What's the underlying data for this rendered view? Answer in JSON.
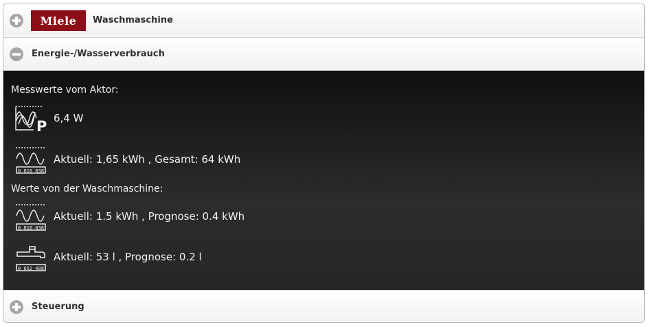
{
  "header": {
    "logo_text": "Miele",
    "device_title": "Waschmaschine",
    "brand_color": "#8c0e18"
  },
  "energy_section": {
    "title": "Energie-/Wasserverbrauch",
    "actor_label": "Messwerte vom Aktor:",
    "power_value": "6,4 W",
    "power_icon": "power-meter-icon",
    "energy_value": "Aktuell: 1,65 kWh , Gesamt: 64 kWh",
    "energy_icon": "electricity-meter-icon",
    "machine_label": "Werte von der Waschmaschine:",
    "machine_energy_value": "Aktuell: 1.5 kWh , Prognose: 0.4 kWh",
    "water_value": "Aktuell: 53 l , Prognose: 0.2 l",
    "water_icon": "water-meter-icon",
    "meter_digits": "0 816 838.5",
    "water_digits": "0 652 488.3"
  },
  "control_section": {
    "title": "Steuerung"
  }
}
